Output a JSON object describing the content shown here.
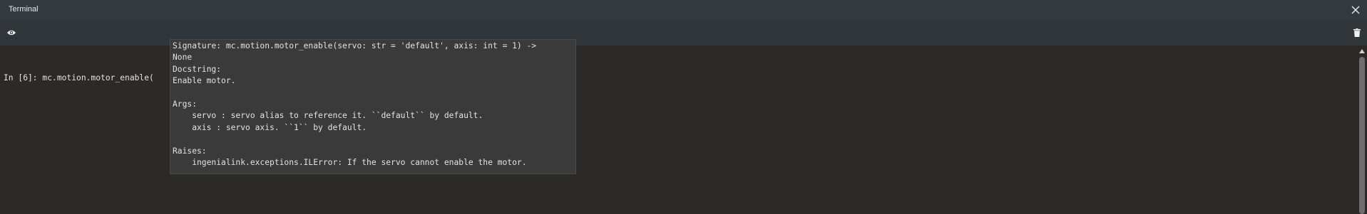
{
  "window": {
    "title": "Terminal"
  },
  "toolbar": {
    "left_icon": "eye-icon",
    "right_icon": "trash-icon"
  },
  "console": {
    "prompt": "In [6]:",
    "input": " mc.motion.motor_enable("
  },
  "tooltip": {
    "lines": [
      "Signature: mc.motion.motor_enable(servo: str = 'default', axis: int = 1) ->",
      "None",
      "Docstring:",
      "Enable motor.",
      "",
      "Args:",
      "    servo : servo alias to reference it. ``default`` by default.",
      "    axis : servo axis. ``1`` by default.",
      "",
      "Raises:",
      "    ingenialink.exceptions.ILError: If the servo cannot enable the motor."
    ]
  },
  "colors": {
    "titlebar_bg": "#323a40",
    "toolbar_bg": "#31363b",
    "console_bg": "#2b2a27",
    "tooltip_bg": "#3a3a3a",
    "text": "#e3e3e3"
  }
}
